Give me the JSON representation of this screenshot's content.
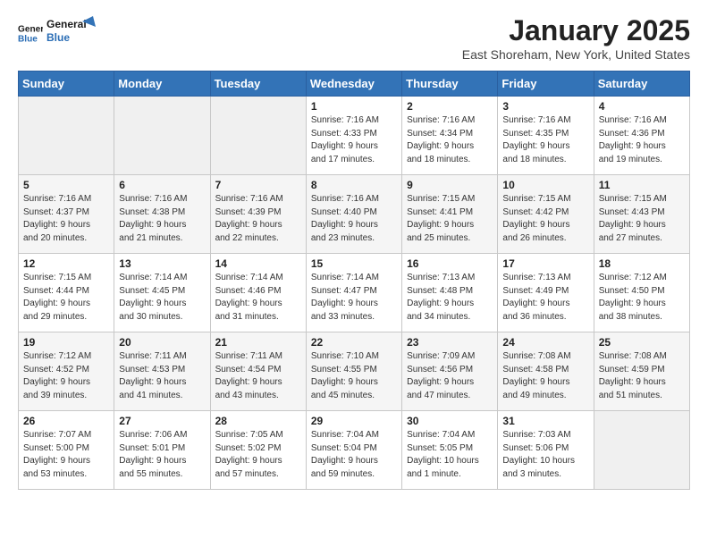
{
  "header": {
    "logo_general": "General",
    "logo_blue": "Blue",
    "title": "January 2025",
    "location": "East Shoreham, New York, United States"
  },
  "weekdays": [
    "Sunday",
    "Monday",
    "Tuesday",
    "Wednesday",
    "Thursday",
    "Friday",
    "Saturday"
  ],
  "weeks": [
    [
      {
        "day": "",
        "info": ""
      },
      {
        "day": "",
        "info": ""
      },
      {
        "day": "",
        "info": ""
      },
      {
        "day": "1",
        "info": "Sunrise: 7:16 AM\nSunset: 4:33 PM\nDaylight: 9 hours\nand 17 minutes."
      },
      {
        "day": "2",
        "info": "Sunrise: 7:16 AM\nSunset: 4:34 PM\nDaylight: 9 hours\nand 18 minutes."
      },
      {
        "day": "3",
        "info": "Sunrise: 7:16 AM\nSunset: 4:35 PM\nDaylight: 9 hours\nand 18 minutes."
      },
      {
        "day": "4",
        "info": "Sunrise: 7:16 AM\nSunset: 4:36 PM\nDaylight: 9 hours\nand 19 minutes."
      }
    ],
    [
      {
        "day": "5",
        "info": "Sunrise: 7:16 AM\nSunset: 4:37 PM\nDaylight: 9 hours\nand 20 minutes."
      },
      {
        "day": "6",
        "info": "Sunrise: 7:16 AM\nSunset: 4:38 PM\nDaylight: 9 hours\nand 21 minutes."
      },
      {
        "day": "7",
        "info": "Sunrise: 7:16 AM\nSunset: 4:39 PM\nDaylight: 9 hours\nand 22 minutes."
      },
      {
        "day": "8",
        "info": "Sunrise: 7:16 AM\nSunset: 4:40 PM\nDaylight: 9 hours\nand 23 minutes."
      },
      {
        "day": "9",
        "info": "Sunrise: 7:15 AM\nSunset: 4:41 PM\nDaylight: 9 hours\nand 25 minutes."
      },
      {
        "day": "10",
        "info": "Sunrise: 7:15 AM\nSunset: 4:42 PM\nDaylight: 9 hours\nand 26 minutes."
      },
      {
        "day": "11",
        "info": "Sunrise: 7:15 AM\nSunset: 4:43 PM\nDaylight: 9 hours\nand 27 minutes."
      }
    ],
    [
      {
        "day": "12",
        "info": "Sunrise: 7:15 AM\nSunset: 4:44 PM\nDaylight: 9 hours\nand 29 minutes."
      },
      {
        "day": "13",
        "info": "Sunrise: 7:14 AM\nSunset: 4:45 PM\nDaylight: 9 hours\nand 30 minutes."
      },
      {
        "day": "14",
        "info": "Sunrise: 7:14 AM\nSunset: 4:46 PM\nDaylight: 9 hours\nand 31 minutes."
      },
      {
        "day": "15",
        "info": "Sunrise: 7:14 AM\nSunset: 4:47 PM\nDaylight: 9 hours\nand 33 minutes."
      },
      {
        "day": "16",
        "info": "Sunrise: 7:13 AM\nSunset: 4:48 PM\nDaylight: 9 hours\nand 34 minutes."
      },
      {
        "day": "17",
        "info": "Sunrise: 7:13 AM\nSunset: 4:49 PM\nDaylight: 9 hours\nand 36 minutes."
      },
      {
        "day": "18",
        "info": "Sunrise: 7:12 AM\nSunset: 4:50 PM\nDaylight: 9 hours\nand 38 minutes."
      }
    ],
    [
      {
        "day": "19",
        "info": "Sunrise: 7:12 AM\nSunset: 4:52 PM\nDaylight: 9 hours\nand 39 minutes."
      },
      {
        "day": "20",
        "info": "Sunrise: 7:11 AM\nSunset: 4:53 PM\nDaylight: 9 hours\nand 41 minutes."
      },
      {
        "day": "21",
        "info": "Sunrise: 7:11 AM\nSunset: 4:54 PM\nDaylight: 9 hours\nand 43 minutes."
      },
      {
        "day": "22",
        "info": "Sunrise: 7:10 AM\nSunset: 4:55 PM\nDaylight: 9 hours\nand 45 minutes."
      },
      {
        "day": "23",
        "info": "Sunrise: 7:09 AM\nSunset: 4:56 PM\nDaylight: 9 hours\nand 47 minutes."
      },
      {
        "day": "24",
        "info": "Sunrise: 7:08 AM\nSunset: 4:58 PM\nDaylight: 9 hours\nand 49 minutes."
      },
      {
        "day": "25",
        "info": "Sunrise: 7:08 AM\nSunset: 4:59 PM\nDaylight: 9 hours\nand 51 minutes."
      }
    ],
    [
      {
        "day": "26",
        "info": "Sunrise: 7:07 AM\nSunset: 5:00 PM\nDaylight: 9 hours\nand 53 minutes."
      },
      {
        "day": "27",
        "info": "Sunrise: 7:06 AM\nSunset: 5:01 PM\nDaylight: 9 hours\nand 55 minutes."
      },
      {
        "day": "28",
        "info": "Sunrise: 7:05 AM\nSunset: 5:02 PM\nDaylight: 9 hours\nand 57 minutes."
      },
      {
        "day": "29",
        "info": "Sunrise: 7:04 AM\nSunset: 5:04 PM\nDaylight: 9 hours\nand 59 minutes."
      },
      {
        "day": "30",
        "info": "Sunrise: 7:04 AM\nSunset: 5:05 PM\nDaylight: 10 hours\nand 1 minute."
      },
      {
        "day": "31",
        "info": "Sunrise: 7:03 AM\nSunset: 5:06 PM\nDaylight: 10 hours\nand 3 minutes."
      },
      {
        "day": "",
        "info": ""
      }
    ]
  ]
}
